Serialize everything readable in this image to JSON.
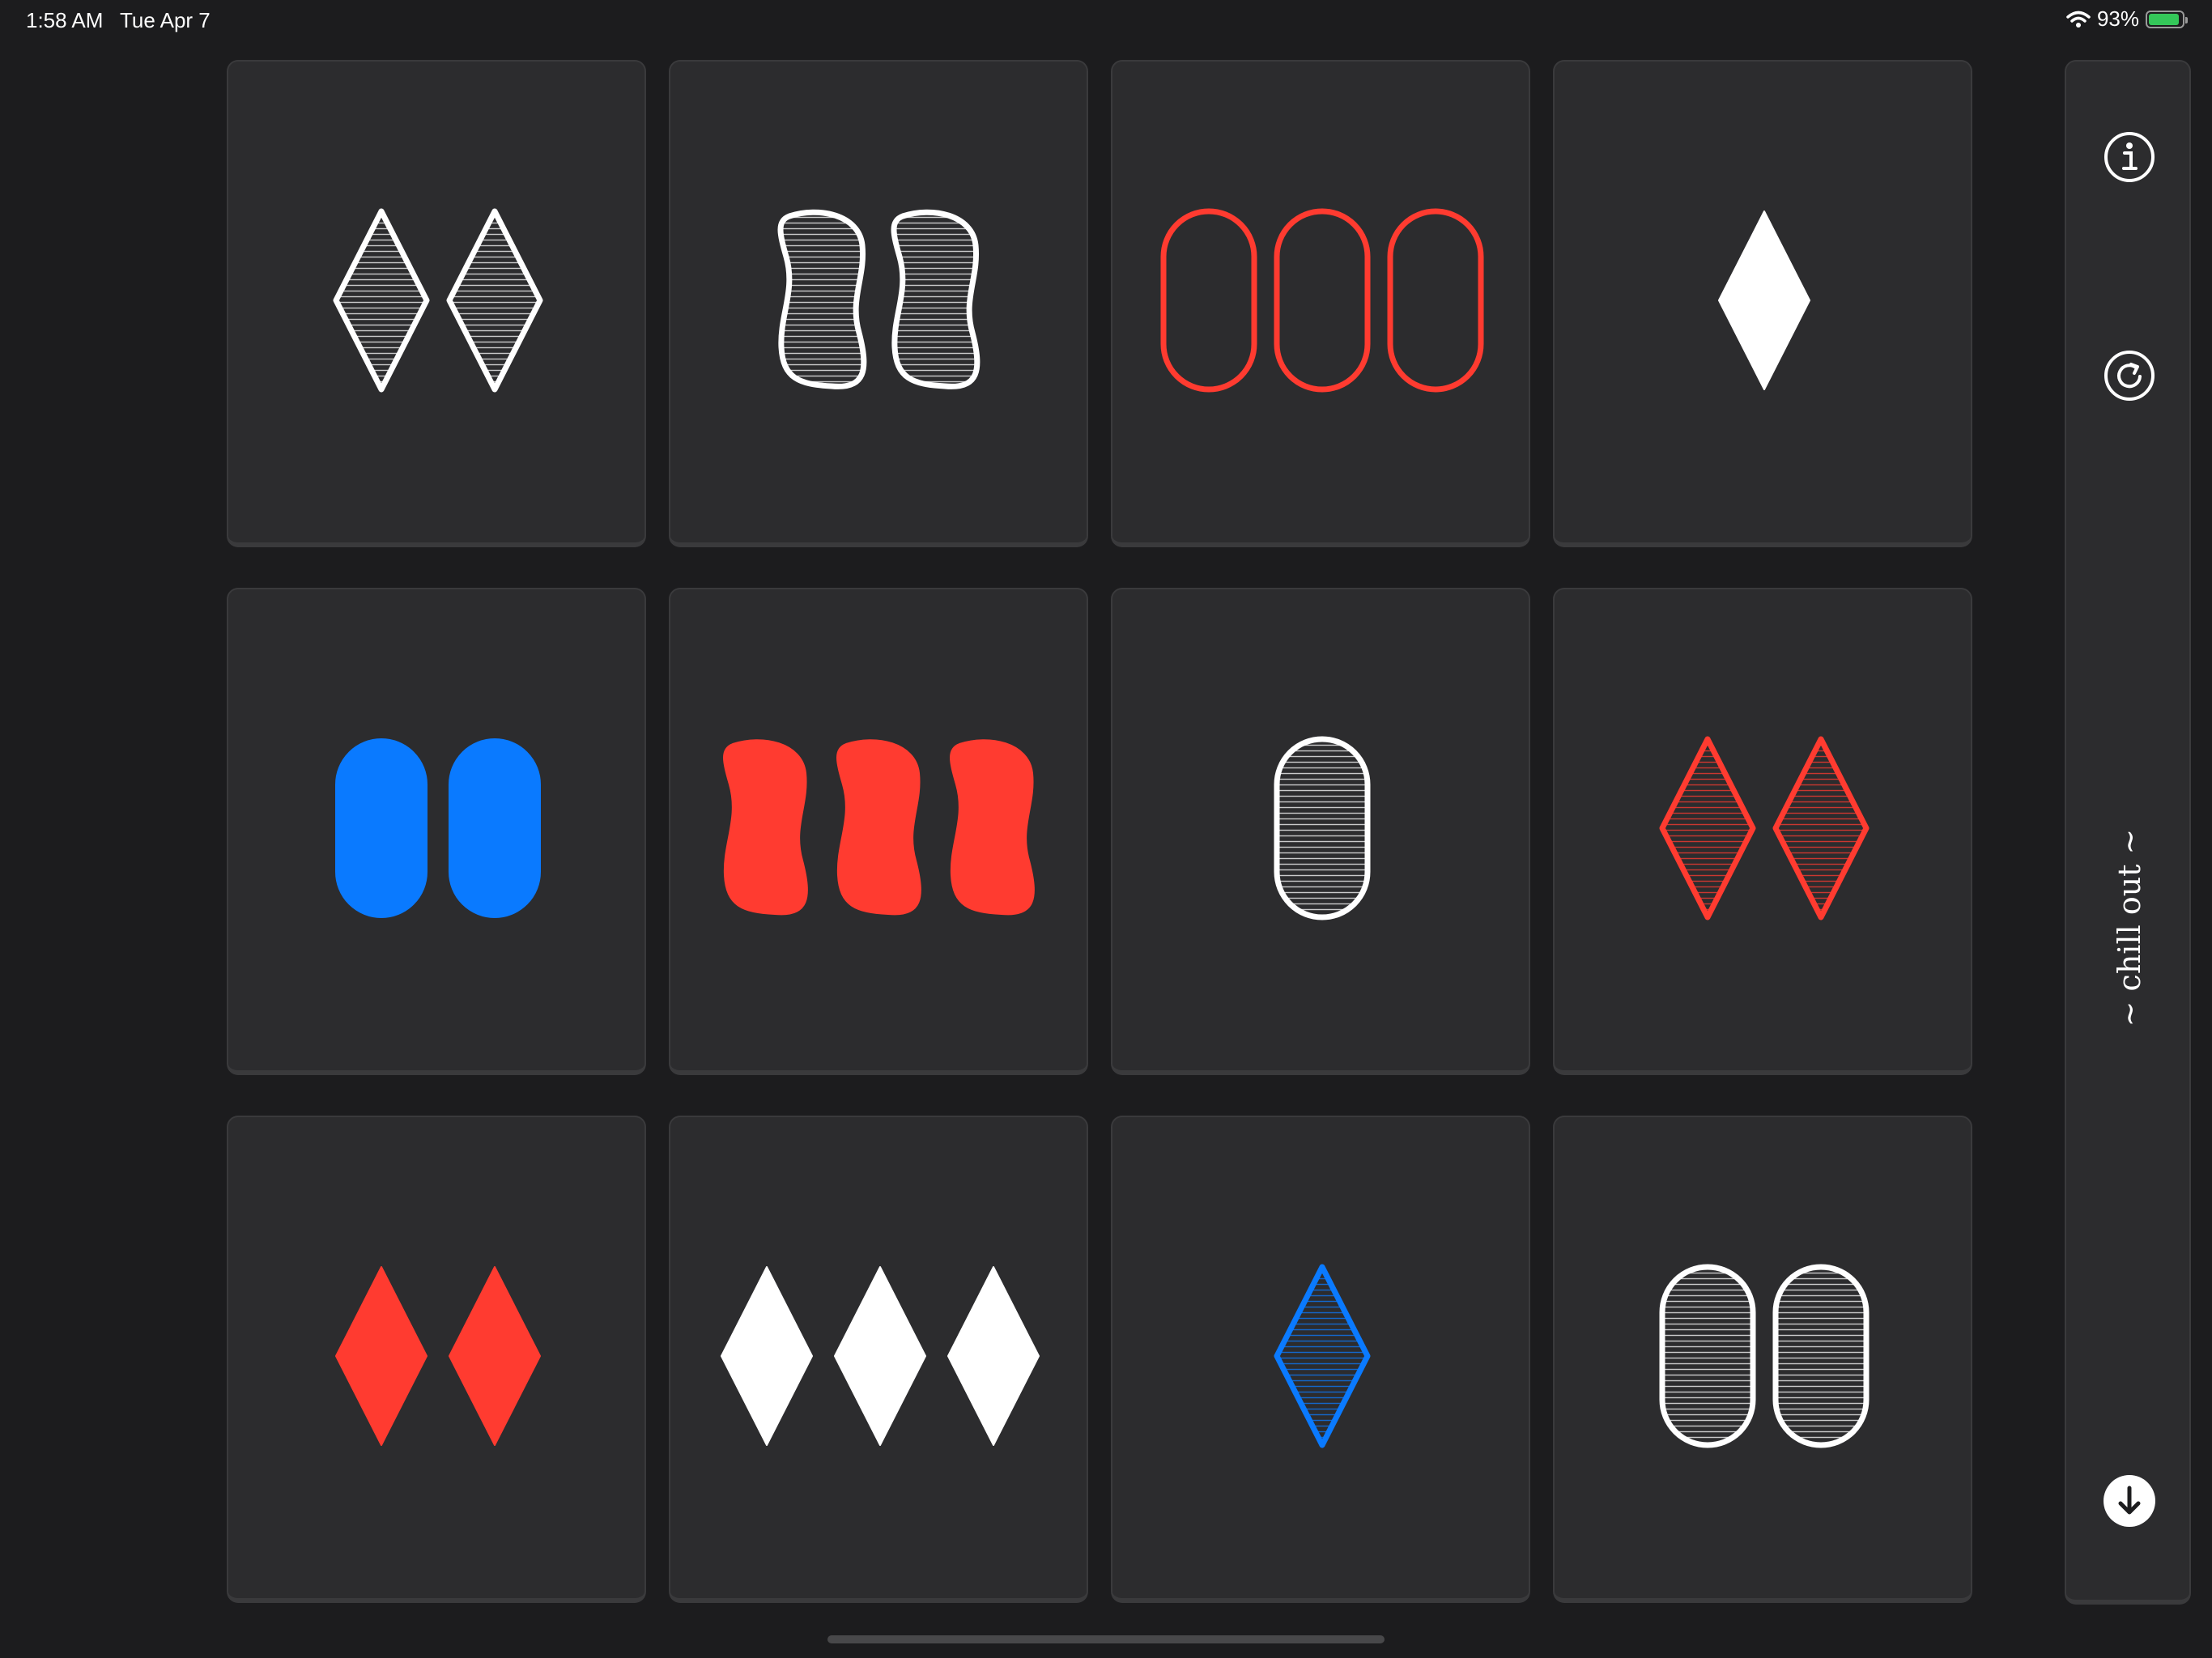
{
  "status_bar": {
    "time": "1:58 AM",
    "date": "Tue Apr 7",
    "battery_percent": "93%",
    "battery_level": 0.93,
    "wifi_icon": "wifi-icon",
    "battery_icon": "battery-charging-icon"
  },
  "colors": {
    "white": "#ffffff",
    "red": "#ff3b30",
    "blue": "#0a7aff",
    "card": "#2c2c2e",
    "background": "#1c1c1e"
  },
  "cards": [
    {
      "count": 2,
      "shape": "diamond",
      "color": "white",
      "shading": "striped"
    },
    {
      "count": 2,
      "shape": "squiggle",
      "color": "white",
      "shading": "striped"
    },
    {
      "count": 3,
      "shape": "oval",
      "color": "red",
      "shading": "open"
    },
    {
      "count": 1,
      "shape": "diamond",
      "color": "white",
      "shading": "solid"
    },
    {
      "count": 2,
      "shape": "oval",
      "color": "blue",
      "shading": "solid"
    },
    {
      "count": 3,
      "shape": "squiggle",
      "color": "red",
      "shading": "solid"
    },
    {
      "count": 1,
      "shape": "oval",
      "color": "white",
      "shading": "striped"
    },
    {
      "count": 2,
      "shape": "diamond",
      "color": "red",
      "shading": "striped"
    },
    {
      "count": 2,
      "shape": "diamond",
      "color": "red",
      "shading": "solid"
    },
    {
      "count": 3,
      "shape": "diamond",
      "color": "white",
      "shading": "solid"
    },
    {
      "count": 1,
      "shape": "diamond",
      "color": "blue",
      "shading": "striped"
    },
    {
      "count": 2,
      "shape": "oval",
      "color": "white",
      "shading": "striped"
    }
  ],
  "side_panel": {
    "info_icon": "info-icon",
    "refresh_icon": "refresh-icon",
    "mode_label": "~ chill out ~",
    "download_icon": "arrow-down-circle-icon"
  }
}
